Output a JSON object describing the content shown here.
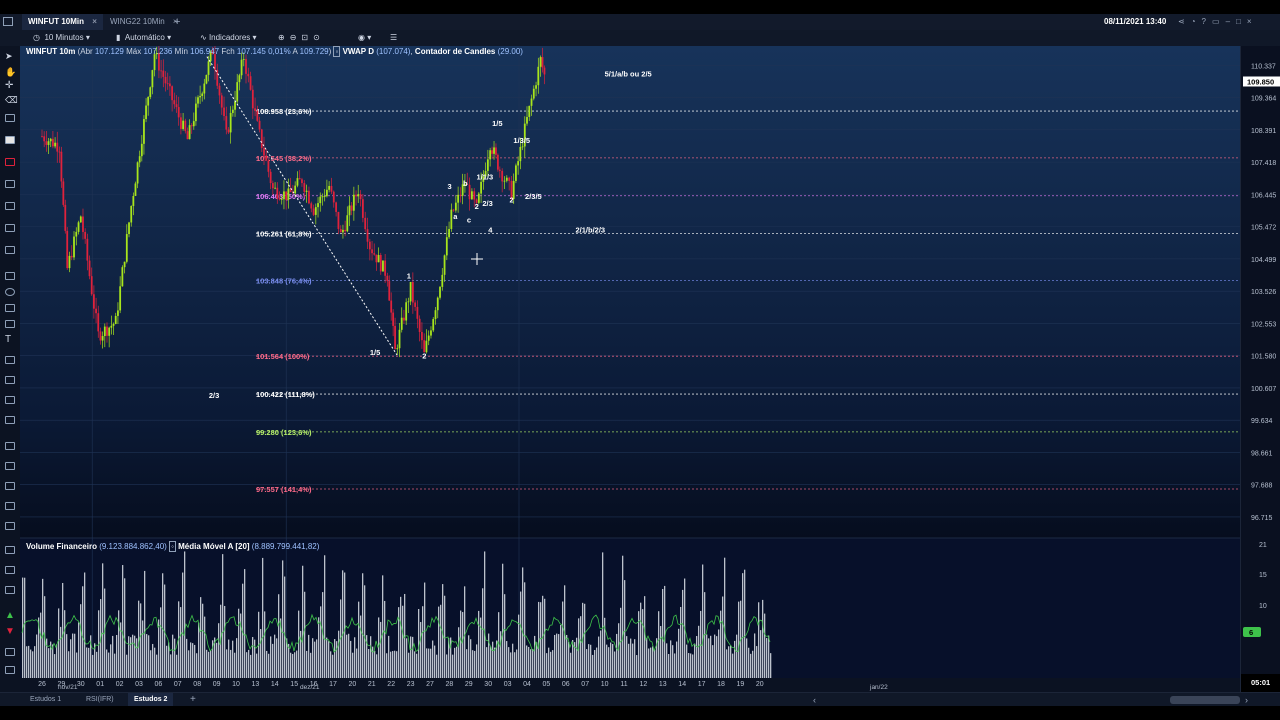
{
  "window": {
    "active_tab": "WINFUT 10Min",
    "second_tab": "WING22 10Min",
    "datetime": "08/11/2021 13:40"
  },
  "toolbar": {
    "timeframe": "10 Minutos",
    "scale_mode": "Automático",
    "indicators_label": "Indicadores"
  },
  "legend": {
    "symbol": "WINFUT 10m",
    "abr_label": "Abr",
    "abr_value": "107.129",
    "max_label": "Máx",
    "max_value": "107.236",
    "min_label": "Mín",
    "min_value": "106.947",
    "fch_label": "Fch",
    "fch_value": "107.145",
    "change": "0,01%",
    "a_label": "A",
    "a_value": "109.729",
    "vwap_label": "VWAP D",
    "vwap_value": "(107.074)",
    "counter_label": "Contador de Candles",
    "counter_value": "(29.00)"
  },
  "volume_legend": {
    "label": "Volume Financeiro",
    "value": "(9.123.884.862,40)",
    "ma_label": "Média Móvel A [20]",
    "ma_value": "(8.889.799.441,82)"
  },
  "bottom_tabs": [
    "Estudos 1",
    "RSI(IFR)",
    "Estudos 2"
  ],
  "colors": {
    "bull": "#a8e61c",
    "bear": "#e0223c",
    "fib_white": "#ffffff",
    "fib_red": "#ff6b8a",
    "fib_magenta": "#e27bf5",
    "fib_blue": "#7b8ff0",
    "fib_green": "#b6f06a",
    "volume": "#d0d6de",
    "volume_ma": "#3ec24a"
  },
  "chart_data": {
    "type": "candlestick",
    "ylim": [
      96.2,
      110.8
    ],
    "price_ticks": [
      "110.337",
      "109.364",
      "108.391",
      "107.418",
      "106.445",
      "105.472",
      "104.499",
      "103.526",
      "102.553",
      "101.580",
      "100.607",
      "99.634",
      "98.661",
      "97.688",
      "96.715"
    ],
    "last_price": "109.850",
    "fib_levels": [
      {
        "price": 108.958,
        "label": "108.958 (23,6%)",
        "color": "#ffffff"
      },
      {
        "price": 107.545,
        "label": "107.545 (38,2%)",
        "color": "#ff6b8a"
      },
      {
        "price": 106.403,
        "label": "106.403 (50%)",
        "color": "#e27bf5"
      },
      {
        "price": 105.261,
        "label": "105.261 (61,8%)",
        "color": "#ffffff"
      },
      {
        "price": 103.848,
        "label": "103.848 (76,4%)",
        "color": "#7b8ff0"
      },
      {
        "price": 101.564,
        "label": "101.564 (100%)",
        "color": "#ff6b8a"
      },
      {
        "price": 100.422,
        "label": "100.422 (111,8%)",
        "color": "#ffffff"
      },
      {
        "price": 99.28,
        "label": "99.280 (123,6%)",
        "color": "#b6f06a"
      },
      {
        "price": 97.557,
        "label": "97.557 (141,4%)",
        "color": "#ff6b8a"
      }
    ],
    "wave_labels": [
      {
        "text": "5/1/a/b ou 2/5",
        "x": 29,
        "y": 110.0
      },
      {
        "text": "1/5",
        "x": 23.2,
        "y": 108.5
      },
      {
        "text": "1/3/5",
        "x": 24.3,
        "y": 108.0
      },
      {
        "text": "3",
        "x": 20.9,
        "y": 106.6
      },
      {
        "text": "b",
        "x": 21.7,
        "y": 106.7
      },
      {
        "text": "1/1/3",
        "x": 22.4,
        "y": 106.9
      },
      {
        "text": "a",
        "x": 21.2,
        "y": 105.7
      },
      {
        "text": "c",
        "x": 21.9,
        "y": 105.6
      },
      {
        "text": "2",
        "x": 22.3,
        "y": 106.0
      },
      {
        "text": "2/3",
        "x": 22.7,
        "y": 106.1
      },
      {
        "text": "4",
        "x": 23.0,
        "y": 105.3
      },
      {
        "text": "2",
        "x": 24.1,
        "y": 106.2
      },
      {
        "text": "2/3/5",
        "x": 24.9,
        "y": 106.3
      },
      {
        "text": "2/1/b/2/3",
        "x": 27.5,
        "y": 105.3
      },
      {
        "text": "1",
        "x": 18.8,
        "y": 103.9
      },
      {
        "text": "1/5",
        "x": 16.9,
        "y": 101.6
      },
      {
        "text": "2",
        "x": 19.6,
        "y": 101.5
      },
      {
        "text": "2/3",
        "x": 8.6,
        "y": 100.3
      }
    ],
    "x_ticks": [
      "26",
      "29",
      "30",
      "01",
      "02",
      "03",
      "06",
      "07",
      "08",
      "09",
      "10",
      "13",
      "14",
      "15",
      "16",
      "17",
      "20",
      "21",
      "22",
      "23",
      "27",
      "28",
      "29",
      "30",
      "03",
      "04",
      "05",
      "06",
      "07",
      "10",
      "11",
      "12",
      "13",
      "14",
      "17",
      "18",
      "19",
      "20"
    ],
    "x_month_labels": [
      "nov/21",
      "dez/21",
      "jan/22"
    ],
    "volume_ticks": [
      "21",
      "15",
      "10",
      "6"
    ],
    "volume_last": "6",
    "time_label": "05:01",
    "swing_points": [
      {
        "x": 0,
        "y": 108.2
      },
      {
        "x": 0.9,
        "y": 107.9
      },
      {
        "x": 1.3,
        "y": 104.2
      },
      {
        "x": 2.0,
        "y": 105.8
      },
      {
        "x": 2.9,
        "y": 102.2
      },
      {
        "x": 3.8,
        "y": 102.6
      },
      {
        "x": 4.6,
        "y": 106.1
      },
      {
        "x": 5.8,
        "y": 110.7
      },
      {
        "x": 7.5,
        "y": 108.1
      },
      {
        "x": 8.8,
        "y": 110.8
      },
      {
        "x": 9.5,
        "y": 108.2
      },
      {
        "x": 10.4,
        "y": 110.6
      },
      {
        "x": 11.1,
        "y": 108.5
      },
      {
        "x": 11.9,
        "y": 106.6
      },
      {
        "x": 12.7,
        "y": 106.4
      },
      {
        "x": 13.4,
        "y": 106.9
      },
      {
        "x": 14.0,
        "y": 106.0
      },
      {
        "x": 14.8,
        "y": 106.7
      },
      {
        "x": 15.4,
        "y": 105.2
      },
      {
        "x": 16.3,
        "y": 106.6
      },
      {
        "x": 16.9,
        "y": 104.9
      },
      {
        "x": 17.8,
        "y": 104.0
      },
      {
        "x": 18.2,
        "y": 101.7
      },
      {
        "x": 19.0,
        "y": 103.6
      },
      {
        "x": 19.7,
        "y": 101.6
      },
      {
        "x": 20.4,
        "y": 103.4
      },
      {
        "x": 21.1,
        "y": 105.8
      },
      {
        "x": 21.8,
        "y": 106.8
      },
      {
        "x": 22.4,
        "y": 106.0
      },
      {
        "x": 23.1,
        "y": 108.0
      },
      {
        "x": 23.6,
        "y": 107.2
      },
      {
        "x": 24.2,
        "y": 106.5
      },
      {
        "x": 25.0,
        "y": 108.7
      },
      {
        "x": 25.7,
        "y": 110.5
      },
      {
        "x": 26.0,
        "y": 109.8
      }
    ],
    "trend_line": {
      "from": {
        "x": 8.5,
        "y": 110.6
      },
      "to": {
        "x": 18.3,
        "y": 101.6
      }
    }
  }
}
